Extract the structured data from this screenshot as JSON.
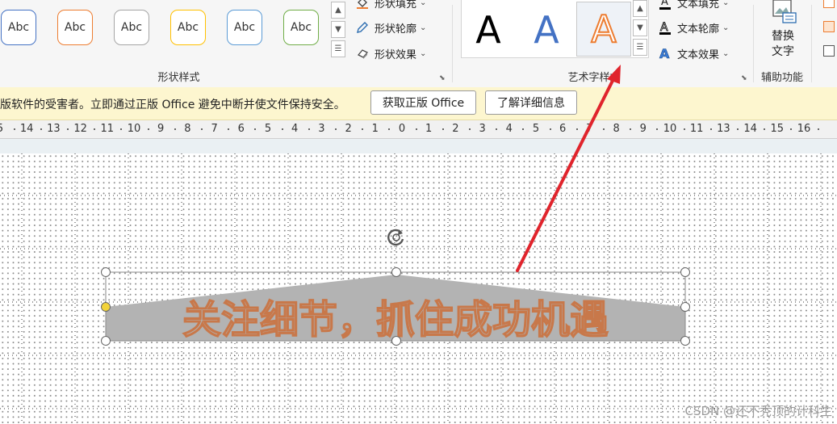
{
  "ribbon": {
    "shape_styles": {
      "label": "形状样式",
      "swatches": [
        {
          "text": "Abc",
          "color": "#4472c4"
        },
        {
          "text": "Abc",
          "color": "#ed7d31"
        },
        {
          "text": "Abc",
          "color": "#a5a5a5"
        },
        {
          "text": "Abc",
          "color": "#ffc000"
        },
        {
          "text": "Abc",
          "color": "#5b9bd5"
        },
        {
          "text": "Abc",
          "color": "#70ad47"
        }
      ],
      "fill": "形状填充",
      "outline": "形状轮廓",
      "effects": "形状效果"
    },
    "wordart": {
      "label": "艺术字样式",
      "samples": [
        {
          "text": "A",
          "color": "#000000"
        },
        {
          "text": "A",
          "color": "#4472c4"
        },
        {
          "text": "A",
          "color": "#ed7d31"
        }
      ],
      "fill": "文本填充",
      "outline": "文本轮廓",
      "effects": "文本效果"
    },
    "accessibility": {
      "label": "辅助功能",
      "alt_text_line1": "替换",
      "alt_text_line2": "文字"
    }
  },
  "message_bar": {
    "text": "版软件的受害者。立即通过正版 Office 避免中断并使文件保持安全。",
    "get_genuine": "获取正版 Office",
    "learn_more": "了解详细信息"
  },
  "ruler": {
    "labels": [
      "5",
      "14",
      "13",
      "12",
      "11",
      "10",
      "9",
      "8",
      "7",
      "6",
      "5",
      "4",
      "3",
      "2",
      "1",
      "0",
      "1",
      "2",
      "3",
      "4",
      "5",
      "6",
      "7",
      "8",
      "9",
      "10",
      "11",
      "13",
      "14",
      "15",
      "16"
    ]
  },
  "wordart_text": "关注细节，抓住成功机遇",
  "watermark": "CSDN @还不秃顶的计科生",
  "colors": {
    "annotation_arrow": "#e0242c",
    "wordart_outline": "#c8784a",
    "shape_fill": "#b3b3b3",
    "adjust_handle": "#f2d33a"
  }
}
